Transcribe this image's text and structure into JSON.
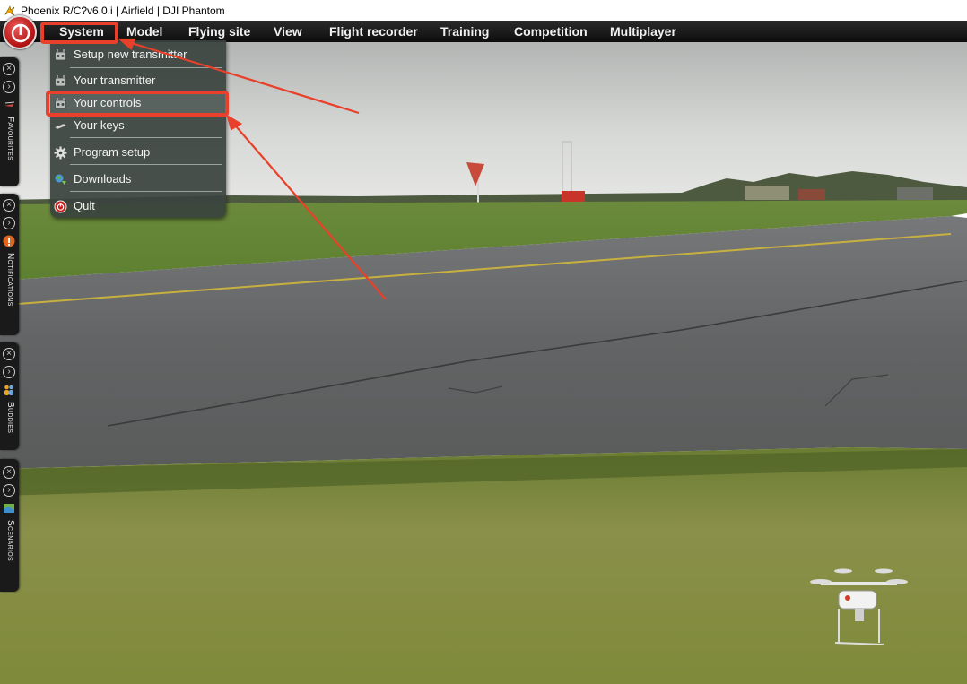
{
  "window": {
    "title": "Phoenix R/C?v6.0.i  |  Airfield  |  DJI Phantom",
    "icon": "phoenix-icon"
  },
  "menubar": {
    "power_icon": "power-icon",
    "items": [
      {
        "label": "System"
      },
      {
        "label": "Model"
      },
      {
        "label": "Flying site"
      },
      {
        "label": "View"
      },
      {
        "label": "Flight recorder"
      },
      {
        "label": "Training"
      },
      {
        "label": "Competition"
      },
      {
        "label": "Multiplayer"
      }
    ]
  },
  "system_menu": {
    "items": [
      {
        "label": "Setup new transmitter",
        "icon": "transmitter-icon"
      },
      {
        "label": "Your transmitter",
        "icon": "transmitter-icon"
      },
      {
        "label": "Your controls",
        "icon": "transmitter-icon",
        "highlighted": true
      },
      {
        "label": "Your keys",
        "icon": "keyboard-icon"
      },
      {
        "label": "Program setup",
        "icon": "gear-icon"
      },
      {
        "label": "Downloads",
        "icon": "globe-icon"
      },
      {
        "label": "Quit",
        "icon": "power-icon"
      }
    ]
  },
  "side_panels": [
    {
      "label": "Favourites",
      "icon": "heli-icon"
    },
    {
      "label": "Notifications",
      "icon": "alert-icon"
    },
    {
      "label": "Buddies",
      "icon": "buddies-icon"
    },
    {
      "label": "Scenarios",
      "icon": "map-icon"
    }
  ],
  "annotation": {
    "color": "#e8402a",
    "highlighted_menu": "System",
    "highlighted_item": "Your controls"
  }
}
